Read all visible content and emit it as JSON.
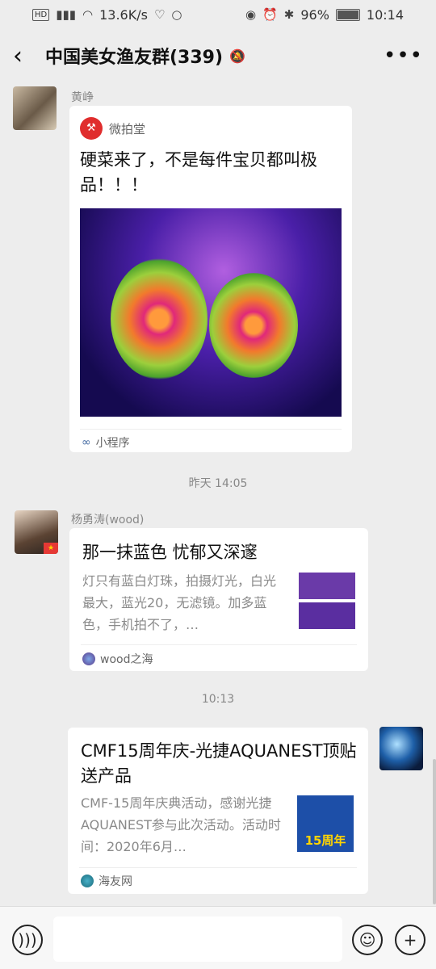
{
  "status_bar": {
    "hd": "HD",
    "net": "4G",
    "speed": "13.6K/s",
    "battery": "96%",
    "time": "10:14"
  },
  "nav": {
    "title": "中国美女渔友群(339)"
  },
  "messages": [
    {
      "sender": "黄峥",
      "app_name": "微拍堂",
      "title": "硬菜来了，不是每件宝贝都叫极品！！！",
      "footer": "小程序"
    },
    {
      "timestamp": "昨天 14:05"
    },
    {
      "sender": "杨勇涛(wood)",
      "title": "那一抹蓝色 忧郁又深邃",
      "desc": "灯只有蓝白灯珠，拍摄灯光，白光最大，蓝光20，无滤镜。加多蓝色，手机拍不了，…",
      "source": "wood之海"
    },
    {
      "timestamp": "10:13"
    },
    {
      "title": "CMF15周年庆-光捷AQUANEST顶贴送产品",
      "desc": "CMF-15周年庆典活动，感谢光捷AQUANEST参与此次活动。活动时间：2020年6月…",
      "source": "海友网",
      "thumb_text": "15周年"
    }
  ],
  "colors": {
    "accent": "#e02d2d",
    "bg": "#ededed"
  }
}
